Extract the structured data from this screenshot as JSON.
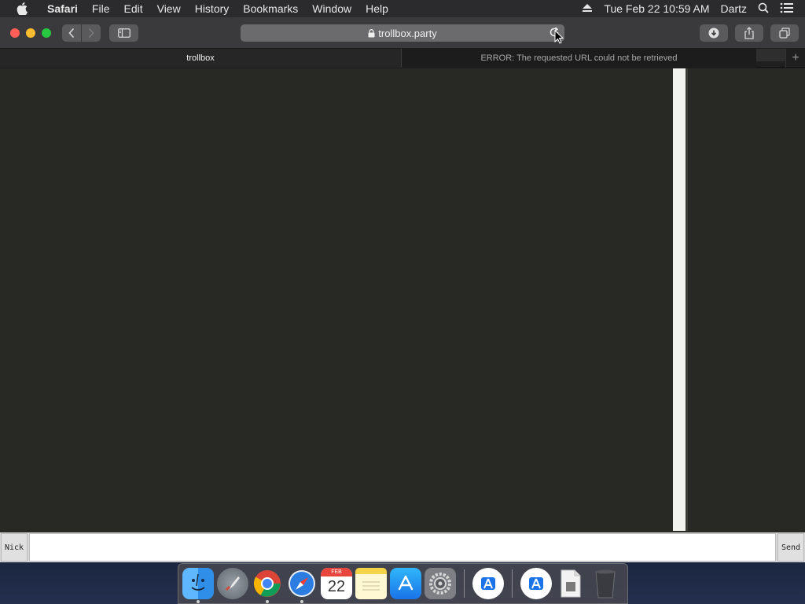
{
  "menubar": {
    "app_name": "Safari",
    "items": [
      "File",
      "Edit",
      "View",
      "History",
      "Bookmarks",
      "Window",
      "Help"
    ],
    "clock": "Tue Feb 22  10:59 AM",
    "user": "Dartz"
  },
  "toolbar": {
    "url": "trollbox.party"
  },
  "tabs": [
    {
      "label": "trollbox",
      "active": true
    },
    {
      "label": "ERROR: The requested URL could not be retrieved",
      "active": false
    }
  ],
  "chat": {
    "nick_label": "Nick",
    "message_value": "",
    "send_label": "Send"
  },
  "dock": {
    "calendar_month": "FEB",
    "calendar_day": "22",
    "items": [
      "finder-icon",
      "launchpad-icon",
      "chrome-icon",
      "safari-icon",
      "calendar-icon",
      "notes-icon",
      "app-store-icon",
      "system-preferences-icon",
      "xcode-installer-icon",
      "xcode-installer-2-icon",
      "file-icon",
      "trash-icon"
    ]
  },
  "colors": {
    "page_bg": "#282824",
    "menubar_bg": "#2b2b2d",
    "toolbar_bg": "#3a3a3c"
  }
}
